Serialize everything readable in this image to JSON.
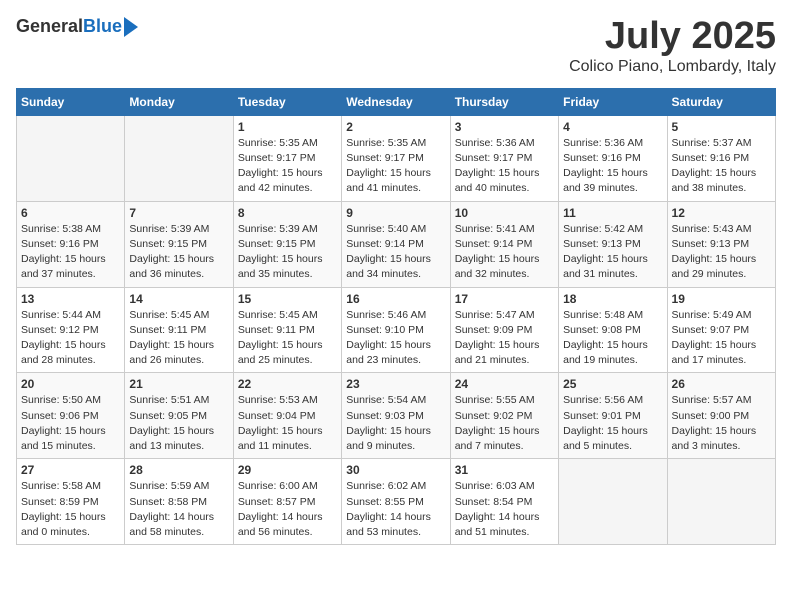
{
  "header": {
    "logo_general": "General",
    "logo_blue": "Blue",
    "month_title": "July 2025",
    "location": "Colico Piano, Lombardy, Italy"
  },
  "days_of_week": [
    "Sunday",
    "Monday",
    "Tuesday",
    "Wednesday",
    "Thursday",
    "Friday",
    "Saturday"
  ],
  "weeks": [
    [
      {
        "day": "",
        "info": ""
      },
      {
        "day": "",
        "info": ""
      },
      {
        "day": "1",
        "info": "Sunrise: 5:35 AM\nSunset: 9:17 PM\nDaylight: 15 hours\nand 42 minutes."
      },
      {
        "day": "2",
        "info": "Sunrise: 5:35 AM\nSunset: 9:17 PM\nDaylight: 15 hours\nand 41 minutes."
      },
      {
        "day": "3",
        "info": "Sunrise: 5:36 AM\nSunset: 9:17 PM\nDaylight: 15 hours\nand 40 minutes."
      },
      {
        "day": "4",
        "info": "Sunrise: 5:36 AM\nSunset: 9:16 PM\nDaylight: 15 hours\nand 39 minutes."
      },
      {
        "day": "5",
        "info": "Sunrise: 5:37 AM\nSunset: 9:16 PM\nDaylight: 15 hours\nand 38 minutes."
      }
    ],
    [
      {
        "day": "6",
        "info": "Sunrise: 5:38 AM\nSunset: 9:16 PM\nDaylight: 15 hours\nand 37 minutes."
      },
      {
        "day": "7",
        "info": "Sunrise: 5:39 AM\nSunset: 9:15 PM\nDaylight: 15 hours\nand 36 minutes."
      },
      {
        "day": "8",
        "info": "Sunrise: 5:39 AM\nSunset: 9:15 PM\nDaylight: 15 hours\nand 35 minutes."
      },
      {
        "day": "9",
        "info": "Sunrise: 5:40 AM\nSunset: 9:14 PM\nDaylight: 15 hours\nand 34 minutes."
      },
      {
        "day": "10",
        "info": "Sunrise: 5:41 AM\nSunset: 9:14 PM\nDaylight: 15 hours\nand 32 minutes."
      },
      {
        "day": "11",
        "info": "Sunrise: 5:42 AM\nSunset: 9:13 PM\nDaylight: 15 hours\nand 31 minutes."
      },
      {
        "day": "12",
        "info": "Sunrise: 5:43 AM\nSunset: 9:13 PM\nDaylight: 15 hours\nand 29 minutes."
      }
    ],
    [
      {
        "day": "13",
        "info": "Sunrise: 5:44 AM\nSunset: 9:12 PM\nDaylight: 15 hours\nand 28 minutes."
      },
      {
        "day": "14",
        "info": "Sunrise: 5:45 AM\nSunset: 9:11 PM\nDaylight: 15 hours\nand 26 minutes."
      },
      {
        "day": "15",
        "info": "Sunrise: 5:45 AM\nSunset: 9:11 PM\nDaylight: 15 hours\nand 25 minutes."
      },
      {
        "day": "16",
        "info": "Sunrise: 5:46 AM\nSunset: 9:10 PM\nDaylight: 15 hours\nand 23 minutes."
      },
      {
        "day": "17",
        "info": "Sunrise: 5:47 AM\nSunset: 9:09 PM\nDaylight: 15 hours\nand 21 minutes."
      },
      {
        "day": "18",
        "info": "Sunrise: 5:48 AM\nSunset: 9:08 PM\nDaylight: 15 hours\nand 19 minutes."
      },
      {
        "day": "19",
        "info": "Sunrise: 5:49 AM\nSunset: 9:07 PM\nDaylight: 15 hours\nand 17 minutes."
      }
    ],
    [
      {
        "day": "20",
        "info": "Sunrise: 5:50 AM\nSunset: 9:06 PM\nDaylight: 15 hours\nand 15 minutes."
      },
      {
        "day": "21",
        "info": "Sunrise: 5:51 AM\nSunset: 9:05 PM\nDaylight: 15 hours\nand 13 minutes."
      },
      {
        "day": "22",
        "info": "Sunrise: 5:53 AM\nSunset: 9:04 PM\nDaylight: 15 hours\nand 11 minutes."
      },
      {
        "day": "23",
        "info": "Sunrise: 5:54 AM\nSunset: 9:03 PM\nDaylight: 15 hours\nand 9 minutes."
      },
      {
        "day": "24",
        "info": "Sunrise: 5:55 AM\nSunset: 9:02 PM\nDaylight: 15 hours\nand 7 minutes."
      },
      {
        "day": "25",
        "info": "Sunrise: 5:56 AM\nSunset: 9:01 PM\nDaylight: 15 hours\nand 5 minutes."
      },
      {
        "day": "26",
        "info": "Sunrise: 5:57 AM\nSunset: 9:00 PM\nDaylight: 15 hours\nand 3 minutes."
      }
    ],
    [
      {
        "day": "27",
        "info": "Sunrise: 5:58 AM\nSunset: 8:59 PM\nDaylight: 15 hours\nand 0 minutes."
      },
      {
        "day": "28",
        "info": "Sunrise: 5:59 AM\nSunset: 8:58 PM\nDaylight: 14 hours\nand 58 minutes."
      },
      {
        "day": "29",
        "info": "Sunrise: 6:00 AM\nSunset: 8:57 PM\nDaylight: 14 hours\nand 56 minutes."
      },
      {
        "day": "30",
        "info": "Sunrise: 6:02 AM\nSunset: 8:55 PM\nDaylight: 14 hours\nand 53 minutes."
      },
      {
        "day": "31",
        "info": "Sunrise: 6:03 AM\nSunset: 8:54 PM\nDaylight: 14 hours\nand 51 minutes."
      },
      {
        "day": "",
        "info": ""
      },
      {
        "day": "",
        "info": ""
      }
    ]
  ]
}
